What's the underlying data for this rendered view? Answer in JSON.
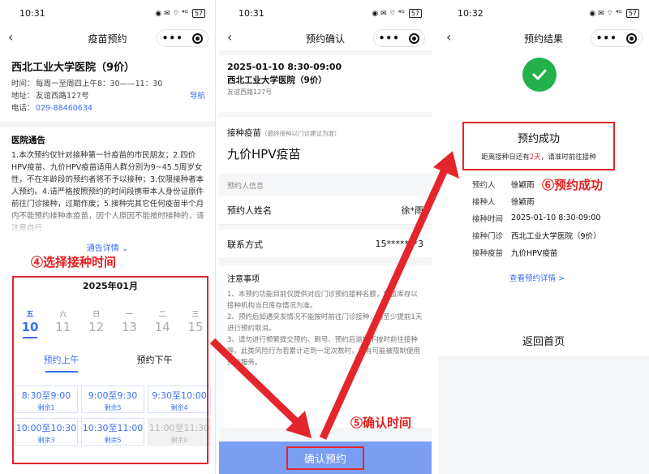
{
  "status": {
    "time1": "10:31",
    "time2": "10:31",
    "time3": "10:32",
    "icons": "◉ ✉ ⌔ ⁴ᴳ",
    "battery": "57"
  },
  "p1": {
    "nav_title": "疫苗预约",
    "hospital": "西北工业大学医院（9价）",
    "time_label": "时间：",
    "time_value": "每周一至周四上午8：30——11：30",
    "addr_label": "地址：",
    "addr_value": "友谊西路127号",
    "nav_link": "导航",
    "phone_label": "电话：",
    "phone_value": "029-88460634",
    "notice_title": "医院通告",
    "notice_body": "1.本次预约仅针对接种第一针疫苗的市民朋友；2.四价HPV疫苗、九价HPV疫苗适用人群分别为9~45.5周岁女性，不在年龄段的预约者将不予以接种；3.仅限接种者本人预约。4.请严格按照预约的时间段携带本人身份证原件前往门诊接种，过期作废；5.接种完其它任何疫苗半个月内不能预约接种本疫苗，因个人原因不能按时接种的，请注意自行",
    "more": "通告详情",
    "month": "2025年01月",
    "days": [
      {
        "w": "五",
        "d": "10"
      },
      {
        "w": "六",
        "d": "11"
      },
      {
        "w": "日",
        "d": "12"
      },
      {
        "w": "一",
        "d": "13"
      },
      {
        "w": "二",
        "d": "14"
      },
      {
        "w": "三",
        "d": "15"
      }
    ],
    "period_am": "预约上午",
    "period_pm": "预约下午",
    "slots": [
      {
        "t": "8:30至9:00",
        "r": "剩余1"
      },
      {
        "t": "9:00至9:30",
        "r": "剩余5"
      },
      {
        "t": "9:30至10:00",
        "r": "剩余4"
      },
      {
        "t": "10:00至10:30",
        "r": "剩余3"
      },
      {
        "t": "10:30至11:00",
        "r": "剩余5"
      },
      {
        "t": "11:00至11:30",
        "r": "剩余0"
      }
    ],
    "caption": "④选择接种时间"
  },
  "p2": {
    "nav_title": "预约确认",
    "datetime": "2025-01-10 8:30-09:00",
    "hospital": "西北工业大学医院（9价）",
    "address": "友谊西路127号",
    "vac_label": "接种疫苗",
    "vac_hint": "（最终接种以门诊建议为准）",
    "vac_name": "九价HPV疫苗",
    "info_title": "预约人信息",
    "name_label": "预约人姓名",
    "name_value": "徐*雨",
    "contact_label": "联系方式",
    "contact_value": "15*******3",
    "notes_title": "注意事项",
    "notes": "1、本预约功能目前仅提供对应门诊预约接种名额，疫苗库存以接种机构当日库存情况为准。\n2、预约后如遇突发情况不能按时前往门诊接种，请至少提前1天进行预约取消。\n3、请勿进行频繁提交预约、刷号、预约后逾期不按时前往接种等，此类风险行为若累计达到一定次数时，将有可能被限制使用预约服务。",
    "confirm": "确认预约",
    "caption": "⑤确认时间"
  },
  "p3": {
    "nav_title": "预约结果",
    "success": "预约成功",
    "sub_before": "距离接种日还有",
    "sub_days": "2天",
    "sub_after": "，请准时前往接种",
    "rows": [
      {
        "k": "预约人",
        "v": "徐颖雨"
      },
      {
        "k": "接种人",
        "v": "徐颖雨"
      },
      {
        "k": "接种时间",
        "v": "2025-01-10 8:30-09:00"
      },
      {
        "k": "接种门诊",
        "v": "西北工业大学医院（9价）"
      },
      {
        "k": "接种疫苗",
        "v": "九价HPV疫苗"
      }
    ],
    "view": "查看预约详情 >",
    "home": "返回首页",
    "caption": "⑥预约成功"
  },
  "colors": {
    "accent": "#3a6ff0",
    "annot_red": "#e3262b",
    "success": "#22b14c"
  }
}
